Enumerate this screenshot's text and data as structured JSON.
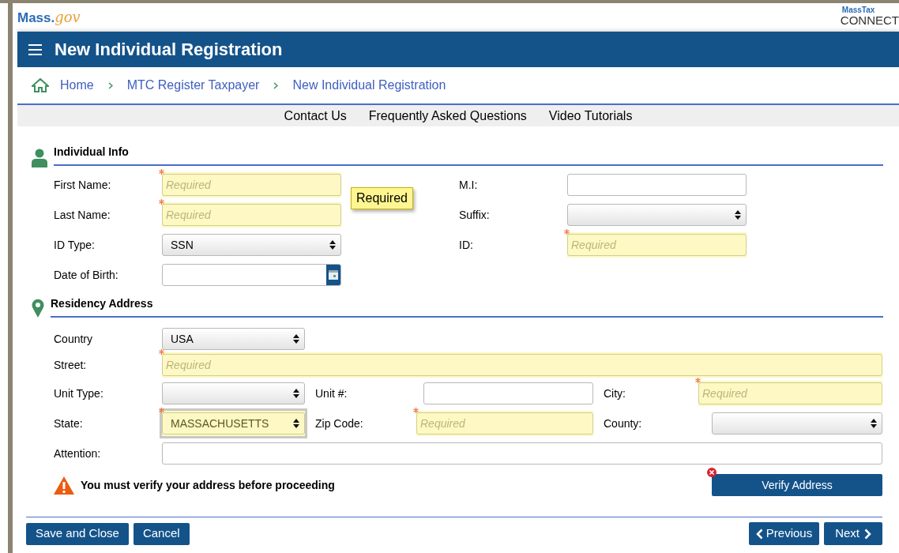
{
  "logos": {
    "site": {
      "main": "Mass.",
      "accent": "gov"
    },
    "product": {
      "top": "MassTax",
      "bottom": "CONNECT"
    }
  },
  "header": {
    "title": "New Individual Registration"
  },
  "breadcrumb": [
    "Home",
    "MTC Register Taxpayer",
    "New Individual Registration"
  ],
  "links": [
    "Contact Us",
    "Frequently Asked Questions",
    "Video Tutorials"
  ],
  "individual_info": {
    "title": "Individual Info",
    "tooltip": "Required",
    "rows": [
      [
        {
          "label": "First Name:",
          "kind": "text",
          "required": true,
          "placeholder": "Required"
        },
        {
          "label": "M.I:",
          "kind": "text",
          "required": false
        }
      ],
      [
        {
          "label": "Last Name:",
          "kind": "text",
          "required": true,
          "placeholder": "Required"
        },
        {
          "label": "Suffix:",
          "kind": "select",
          "required": false
        }
      ],
      [
        {
          "label": "ID Type:",
          "kind": "select",
          "required": false,
          "value": "SSN"
        },
        {
          "label": "ID:",
          "kind": "text",
          "required": true,
          "placeholder": "Required"
        }
      ],
      [
        {
          "label": "Date of Birth:",
          "kind": "date",
          "required": false
        }
      ]
    ]
  },
  "residency_address": {
    "title": "Residency Address",
    "country": {
      "label": "Country",
      "kind": "select",
      "required": false,
      "value": "USA"
    },
    "street": {
      "label": "Street:",
      "kind": "text",
      "required": true,
      "placeholder": "Required"
    },
    "row_unit": [
      {
        "label": "Unit Type:",
        "kind": "select",
        "required": false
      },
      {
        "label": "Unit #:",
        "kind": "text",
        "required": false
      },
      {
        "label": "City:",
        "kind": "text",
        "required": true,
        "placeholder": "Required"
      }
    ],
    "row_state": [
      {
        "label": "State:",
        "kind": "select",
        "required": true,
        "value": "MASSACHUSETTS",
        "focused": true
      },
      {
        "label": "Zip Code:",
        "kind": "text",
        "required": true,
        "placeholder": "Required"
      },
      {
        "label": "County:",
        "kind": "select",
        "required": false
      }
    ],
    "attention": {
      "label": "Attention:",
      "kind": "text",
      "required": false
    },
    "warning": "You must verify your address before proceeding",
    "verify_button": "Verify Address",
    "verify_error": true
  },
  "footer": {
    "left_buttons": [
      "Save and Close",
      "Cancel"
    ],
    "previous": "Previous",
    "next": "Next"
  }
}
